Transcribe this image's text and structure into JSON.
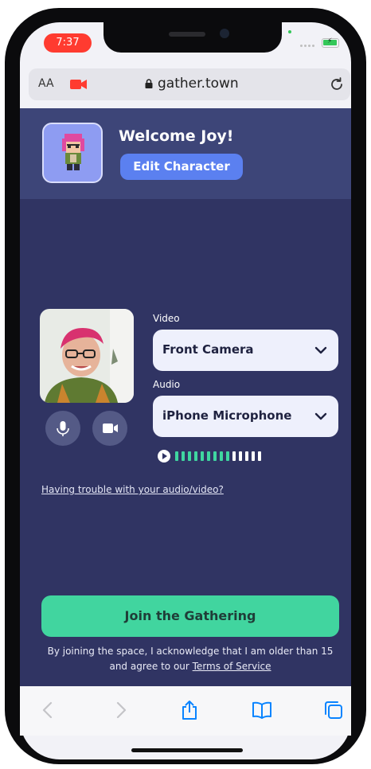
{
  "status_bar": {
    "time": "7:37"
  },
  "browser": {
    "text_size_label": "AA",
    "domain": "gather.town"
  },
  "header": {
    "welcome_text": "Welcome Joy!",
    "edit_character_label": "Edit Character"
  },
  "media": {
    "video_label": "Video",
    "video_selected": "Front Camera",
    "audio_label": "Audio",
    "audio_selected": "iPhone Microphone",
    "audio_level_bars_active": 9,
    "audio_level_bars_total": 14
  },
  "help_link": "Having trouble with your audio/video?",
  "join_button_label": "Join the Gathering",
  "disclaimer": {
    "line1": "By joining the space, I acknowledge that I am older than 15",
    "line2_prefix": "and agree to our ",
    "terms_link": "Terms of Service"
  },
  "colors": {
    "app_background": "#303463",
    "header_background": "#3d4578",
    "primary_button": "#5b80f0",
    "join_button": "#41d59f",
    "record_indicator": "#ff3b30",
    "ios_blue": "#0a84ff"
  },
  "icons": [
    "video-camera-icon",
    "lock-icon",
    "reload-icon",
    "chevron-down-icon",
    "microphone-icon",
    "camera-icon",
    "play-icon",
    "back-icon",
    "forward-icon",
    "share-icon",
    "bookmarks-icon",
    "tabs-icon"
  ]
}
